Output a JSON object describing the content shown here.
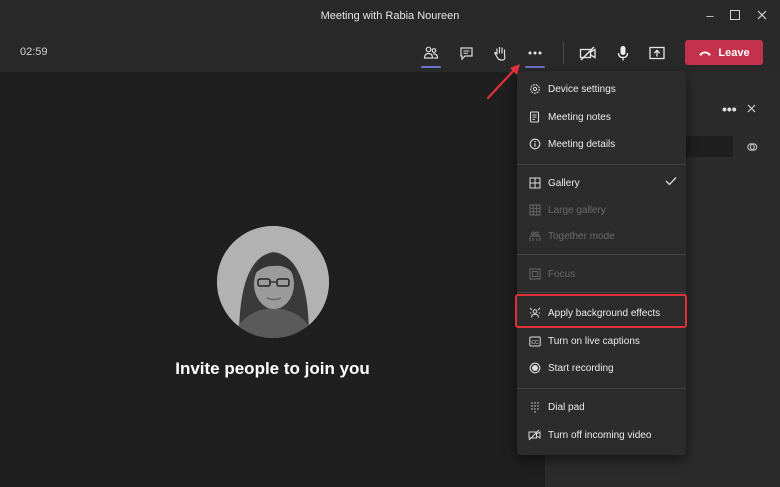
{
  "window": {
    "title": "Meeting with Rabia Noureen"
  },
  "toolbar": {
    "timer": "02:59",
    "leave_label": "Leave"
  },
  "stage": {
    "invite_text": "Invite people to join you"
  },
  "menu": {
    "items": [
      {
        "label": "Device settings",
        "icon": "gear-icon",
        "disabled": false
      },
      {
        "label": "Meeting notes",
        "icon": "notes-icon",
        "disabled": false
      },
      {
        "label": "Meeting details",
        "icon": "info-icon",
        "disabled": false
      },
      {
        "label": "Gallery",
        "icon": "gallery-icon",
        "disabled": false,
        "checked": true
      },
      {
        "label": "Large gallery",
        "icon": "large-gallery-icon",
        "disabled": true
      },
      {
        "label": "Together mode",
        "icon": "together-mode-icon",
        "disabled": true
      },
      {
        "label": "Focus",
        "icon": "focus-icon",
        "disabled": true
      },
      {
        "label": "Apply background effects",
        "icon": "background-effects-icon",
        "disabled": false
      },
      {
        "label": "Turn on live captions",
        "icon": "captions-icon",
        "disabled": false
      },
      {
        "label": "Start recording",
        "icon": "record-icon",
        "disabled": false
      },
      {
        "label": "Dial pad",
        "icon": "dial-pad-icon",
        "disabled": false
      },
      {
        "label": "Turn off incoming video",
        "icon": "video-off-icon",
        "disabled": false
      }
    ]
  },
  "colors": {
    "accent": "#6b73c9",
    "leave": "#c4314b",
    "highlight": "#e0313a",
    "arrow": "#e0313a"
  }
}
